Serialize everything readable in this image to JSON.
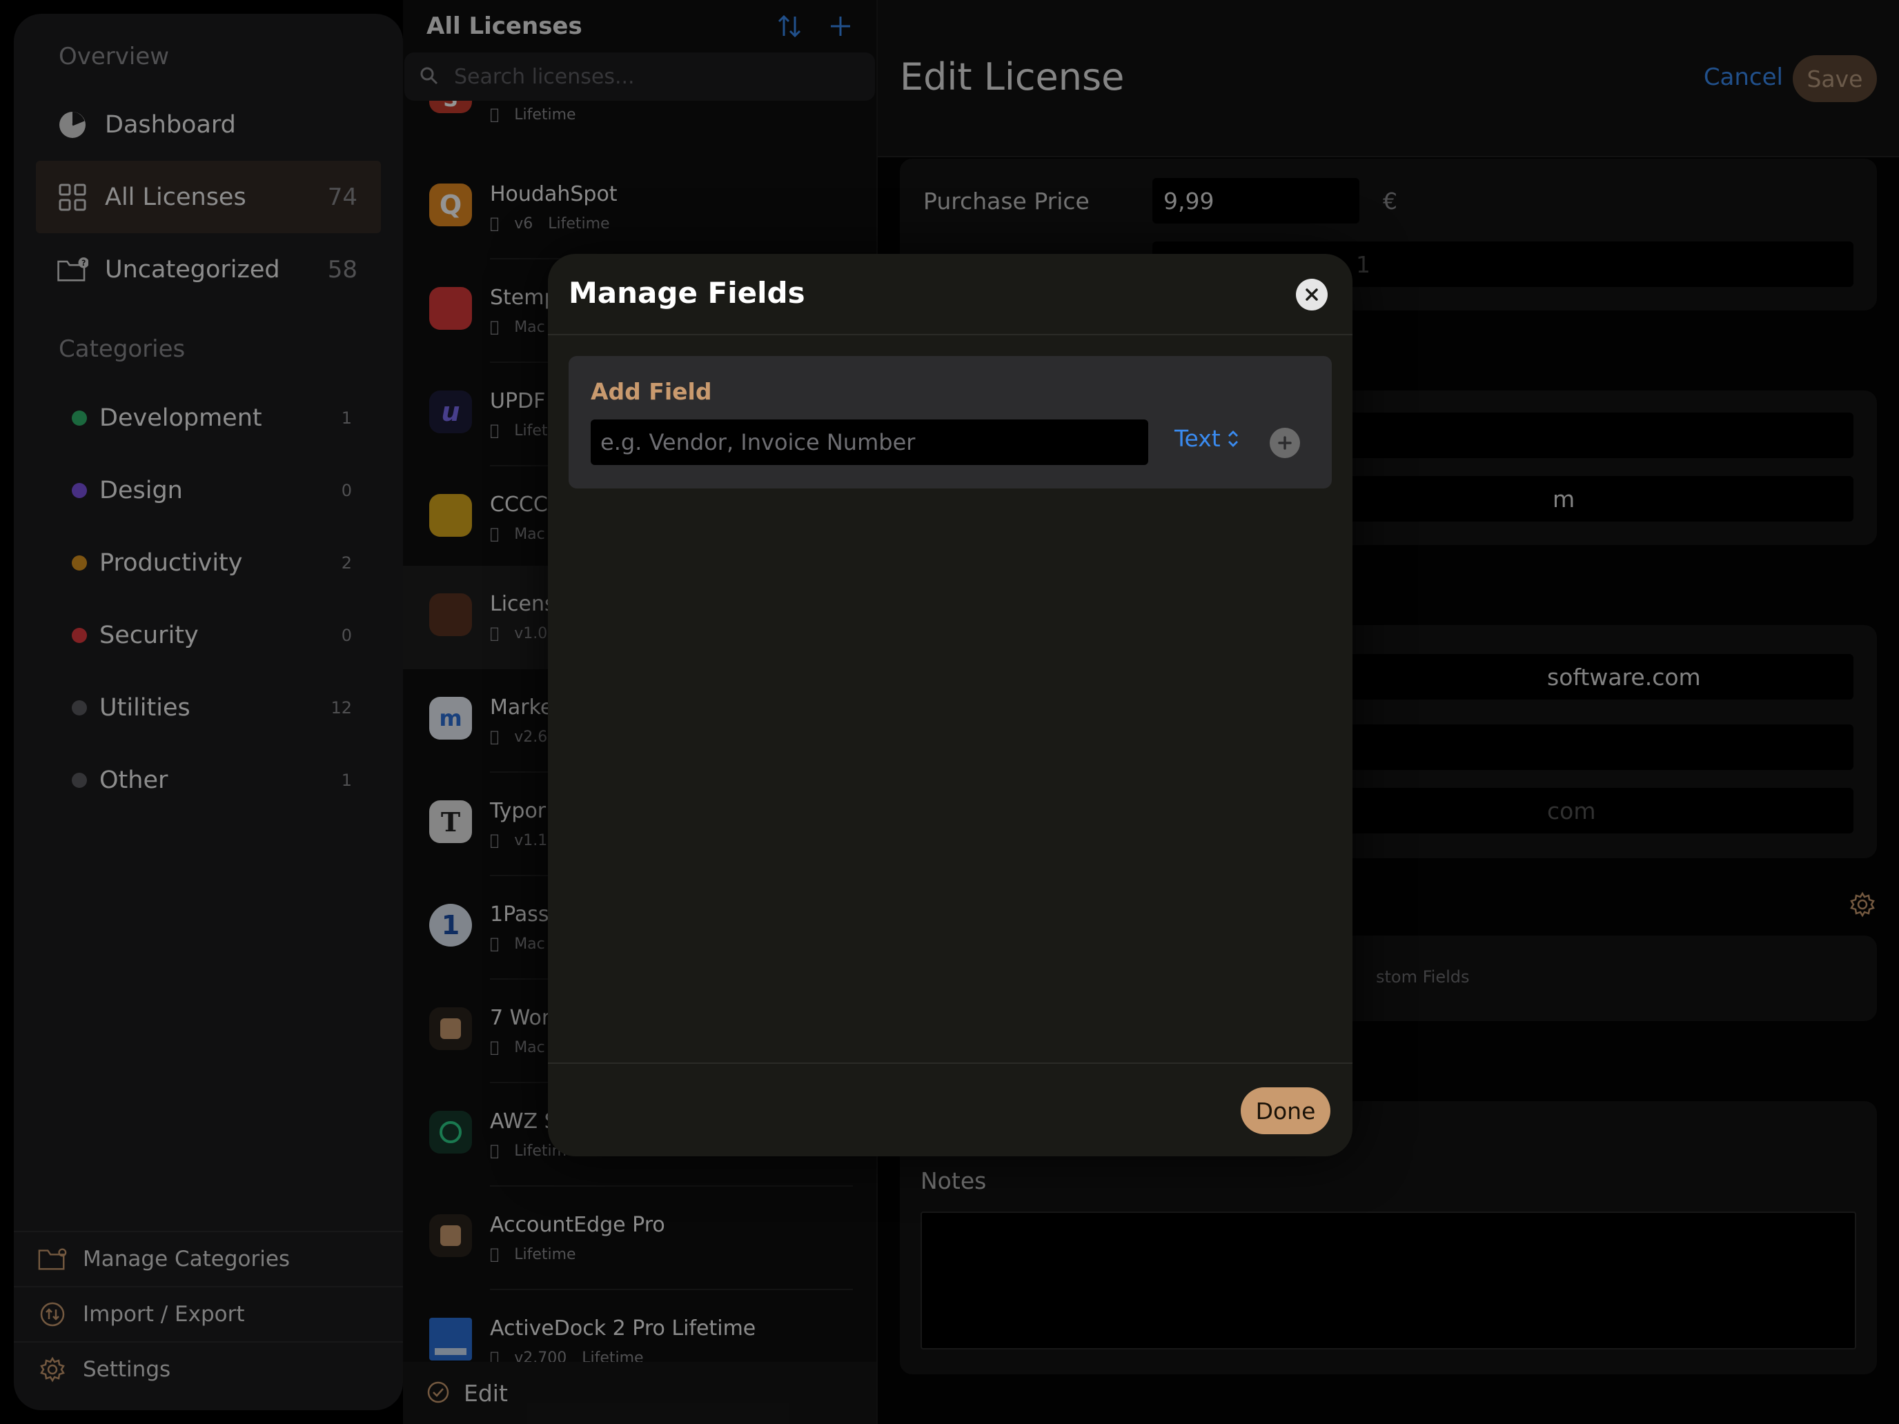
{
  "sidebar": {
    "overview_label": "Overview",
    "categories_label": "Categories",
    "items": [
      {
        "label": "Dashboard",
        "count": "",
        "icon": "pie-chart-icon"
      },
      {
        "label": "All Licenses",
        "count": "74",
        "icon": "grid-icon"
      },
      {
        "label": "Uncategorized",
        "count": "58",
        "icon": "folder-question-icon"
      }
    ],
    "categories": [
      {
        "label": "Development",
        "count": "1",
        "color": "#30b36b"
      },
      {
        "label": "Design",
        "count": "0",
        "color": "#7b52e0"
      },
      {
        "label": "Productivity",
        "count": "2",
        "color": "#d9931f"
      },
      {
        "label": "Security",
        "count": "0",
        "color": "#e0393e"
      },
      {
        "label": "Utilities",
        "count": "12",
        "color": "#5a5a60"
      },
      {
        "label": "Other",
        "count": "1",
        "color": "#5a5a60"
      }
    ],
    "bottom": [
      {
        "label": "Manage Categories",
        "icon": "folder-gear-icon"
      },
      {
        "label": "Import / Export",
        "icon": "arrows-circle-icon"
      },
      {
        "label": "Settings",
        "icon": "gear-icon"
      }
    ]
  },
  "list": {
    "title": "All Licenses",
    "search_placeholder": "Search licenses...",
    "edit_label": "Edit",
    "rows": [
      {
        "name": "",
        "meta": [
          "Lifetime"
        ],
        "icon_letter": "S",
        "icon_bg": "#c43b2e"
      },
      {
        "name": "HoudahSpot",
        "meta": [
          "v6",
          "Lifetime"
        ],
        "icon_letter": "Q",
        "icon_bg": "#e38a22"
      },
      {
        "name": "Stemp",
        "meta": [
          "Mac"
        ],
        "icon_letter": "",
        "icon_bg": "#d83a3a"
      },
      {
        "name": "UPDF",
        "meta": [
          "Lifet"
        ],
        "icon_letter": "u",
        "icon_bg": "#1d1d3a"
      },
      {
        "name": "CCCC",
        "meta": [
          "Mac"
        ],
        "icon_letter": "",
        "icon_bg": "#d8a81c"
      },
      {
        "name": "Licens",
        "meta": [
          "v1.0."
        ],
        "icon_letter": "",
        "icon_bg": "#5a3322"
      },
      {
        "name": "Marke",
        "meta": [
          "v2.6."
        ],
        "icon_letter": "m",
        "icon_bg": "#e8eef6"
      },
      {
        "name": "Typor",
        "meta": [
          "v1.12"
        ],
        "icon_letter": "T",
        "icon_bg": "#e6e6e6"
      },
      {
        "name": "1Pass",
        "meta": [
          "Mac"
        ],
        "icon_letter": "1",
        "icon_bg": "#dde6f2"
      },
      {
        "name": "7 Wor",
        "meta": [
          "Mac"
        ],
        "icon_letter": "",
        "icon_bg": "#2a231d"
      },
      {
        "name": "AWZ S",
        "meta": [
          "Lifetim"
        ],
        "icon_letter": "",
        "icon_bg": "#153a2c"
      },
      {
        "name": "AccountEdge Pro",
        "meta": [
          "Lifetime"
        ],
        "icon_letter": "",
        "icon_bg": "#2a231d"
      },
      {
        "name": "ActiveDock 2 Pro Lifetime",
        "meta": [
          "v2.700",
          "Lifetime"
        ],
        "icon_letter": "",
        "icon_bg": "#2a6fd6"
      }
    ]
  },
  "editor": {
    "title": "Edit License",
    "cancel_label": "Cancel",
    "save_label": "Save",
    "purchase_price_label": "Purchase Price",
    "purchase_price_value": "9,99",
    "currency_symbol": "€",
    "partial_1": "1",
    "partial_2": "m",
    "partial_3": "software.com",
    "partial_4": "com",
    "custom_fields_partial": "stom Fields",
    "notes_label": "Notes"
  },
  "modal": {
    "title": "Manage Fields",
    "add_field_title": "Add Field",
    "add_field_placeholder": "e.g. Vendor, Invoice Number",
    "type_selected": "Text",
    "done_label": "Done"
  },
  "colors": {
    "accent": "#c99a6e",
    "link_blue": "#3a8bf0"
  }
}
